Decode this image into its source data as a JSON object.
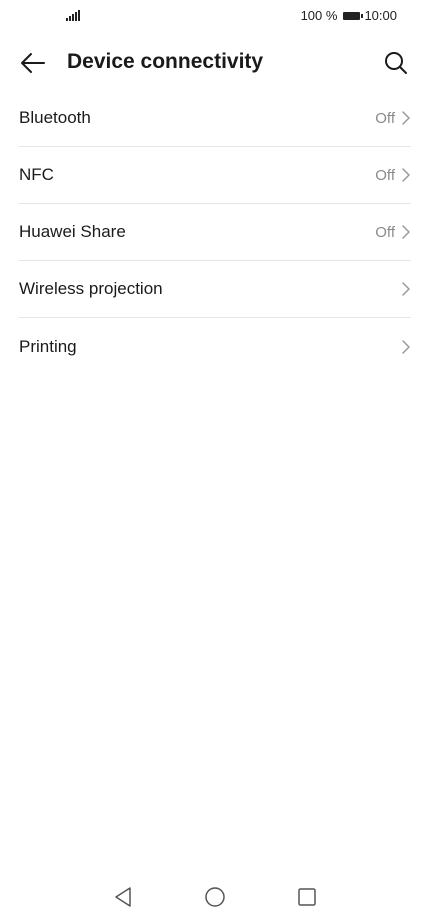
{
  "status_bar": {
    "battery_percent": "100 %",
    "time": "10:00"
  },
  "header": {
    "title": "Device connectivity",
    "back_icon": "arrow-left-icon",
    "search_icon": "search-icon"
  },
  "list": {
    "items": [
      {
        "label": "Bluetooth",
        "status": "Off"
      },
      {
        "label": "NFC",
        "status": "Off"
      },
      {
        "label": "Huawei Share",
        "status": "Off"
      },
      {
        "label": "Wireless projection",
        "status": ""
      },
      {
        "label": "Printing",
        "status": ""
      }
    ]
  },
  "nav_bar": {
    "back_icon": "triangle-back-icon",
    "home_icon": "circle-home-icon",
    "recents_icon": "square-recents-icon"
  },
  "colors": {
    "background": "#ffffff",
    "text": "#1a1a1a",
    "secondary_text": "#8a8a8a",
    "divider": "#e6e6e6"
  }
}
